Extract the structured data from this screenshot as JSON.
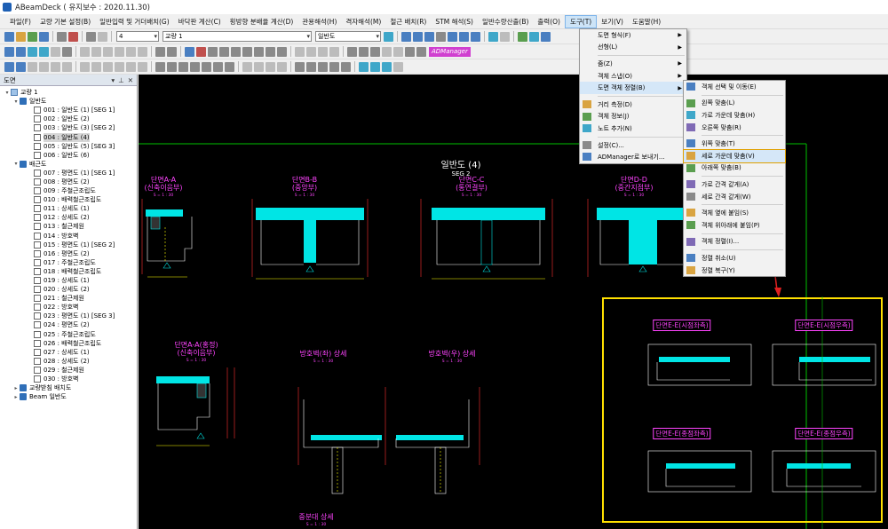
{
  "app": {
    "title": "ABeamDeck  ( 유지보수 : 2020.11.30)"
  },
  "menubar": [
    "파일(F)",
    "교량 기본 설정(B)",
    "일반입력 및 거더배치(G)",
    "바닥판 계산(C)",
    "횡방향 분배율 계산(D)",
    "관용해석(H)",
    "격자해석(M)",
    "철근 배치(R)",
    "STM 해석(S)",
    "일반수량산출(B)",
    "출력(O)",
    "도구(T)",
    "보기(V)",
    "도움말(H)"
  ],
  "toolbar": {
    "page_input": "4",
    "bridge_select": "교량 1",
    "drawing_select": "일반도",
    "admanager": "ADManager"
  },
  "panel": {
    "title": "도면",
    "tree": [
      {
        "level": 0,
        "label": "교량 1",
        "type": "root",
        "toggle": "▾"
      },
      {
        "level": 1,
        "label": "일반도",
        "type": "folder",
        "toggle": "▾"
      },
      {
        "level": 2,
        "label": "001 : 일반도 (1) [SEG 1]",
        "type": "doc"
      },
      {
        "level": 2,
        "label": "002 : 일반도 (2)",
        "type": "doc"
      },
      {
        "level": 2,
        "label": "003 : 일반도 (3) [SEG 2]",
        "type": "doc"
      },
      {
        "level": 2,
        "label": "004 : 일반도 (4)",
        "type": "doc",
        "selected": true
      },
      {
        "level": 2,
        "label": "005 : 일반도 (5) [SEG 3]",
        "type": "doc"
      },
      {
        "level": 2,
        "label": "006 : 일반도 (6)",
        "type": "doc"
      },
      {
        "level": 1,
        "label": "배근도",
        "type": "folder",
        "toggle": "▾"
      },
      {
        "level": 2,
        "label": "007 : 평면도 (1) [SEG 1]",
        "type": "doc"
      },
      {
        "level": 2,
        "label": "008 : 평면도 (2)",
        "type": "doc"
      },
      {
        "level": 2,
        "label": "009 : 주철근조립도",
        "type": "doc"
      },
      {
        "level": 2,
        "label": "010 : 배력철근조립도",
        "type": "doc"
      },
      {
        "level": 2,
        "label": "011 : 상세도 (1)",
        "type": "doc"
      },
      {
        "level": 2,
        "label": "012 : 상세도 (2)",
        "type": "doc"
      },
      {
        "level": 2,
        "label": "013 : 철근제원",
        "type": "doc"
      },
      {
        "level": 2,
        "label": "014 : 방호벽",
        "type": "doc"
      },
      {
        "level": 2,
        "label": "015 : 평면도 (1) [SEG 2]",
        "type": "doc"
      },
      {
        "level": 2,
        "label": "016 : 평면도 (2)",
        "type": "doc"
      },
      {
        "level": 2,
        "label": "017 : 주철근조립도",
        "type": "doc"
      },
      {
        "level": 2,
        "label": "018 : 배력철근조립도",
        "type": "doc"
      },
      {
        "level": 2,
        "label": "019 : 상세도 (1)",
        "type": "doc"
      },
      {
        "level": 2,
        "label": "020 : 상세도 (2)",
        "type": "doc"
      },
      {
        "level": 2,
        "label": "021 : 철근제원",
        "type": "doc"
      },
      {
        "level": 2,
        "label": "022 : 방호벽",
        "type": "doc"
      },
      {
        "level": 2,
        "label": "023 : 평면도 (1) [SEG 3]",
        "type": "doc"
      },
      {
        "level": 2,
        "label": "024 : 평면도 (2)",
        "type": "doc"
      },
      {
        "level": 2,
        "label": "025 : 주철근조립도",
        "type": "doc"
      },
      {
        "level": 2,
        "label": "026 : 배력철근조립도",
        "type": "doc"
      },
      {
        "level": 2,
        "label": "027 : 상세도 (1)",
        "type": "doc"
      },
      {
        "level": 2,
        "label": "028 : 상세도 (2)",
        "type": "doc"
      },
      {
        "level": 2,
        "label": "029 : 철근제원",
        "type": "doc"
      },
      {
        "level": 2,
        "label": "030 : 방호벽",
        "type": "doc"
      },
      {
        "level": 1,
        "label": "교량받침 배치도",
        "type": "folder",
        "toggle": "▸"
      },
      {
        "level": 1,
        "label": "Beam 일반도",
        "type": "folder",
        "toggle": "▸"
      }
    ]
  },
  "drawing": {
    "title": "일반도 (4)",
    "seg": "SEG 2",
    "section_labels": [
      [
        "단면A-A",
        "(신축이음부)"
      ],
      [
        "단면B-B",
        "(중앙부)"
      ],
      [
        "단면C-C",
        "(통연결부)"
      ],
      [
        "단면D-D",
        "(중간지점부)"
      ],
      [
        "단면A-A(홍정)",
        "(신축이음부)"
      ],
      [
        "방호벽(좌) 상세"
      ],
      [
        "방호벽(우) 상세"
      ],
      [
        "중분대 상세"
      ]
    ],
    "scale_note": "S = 1 : 30",
    "box_labels": [
      "단면E-E(시점좌측)",
      "단면E-E(시점우측)",
      "단면E-E(종점좌측)",
      "단면E-E(종점우측)"
    ]
  },
  "tools_menu": [
    {
      "label": "도면 형식(F)",
      "sub": true
    },
    {
      "label": "선형(L)",
      "sub": true
    },
    {
      "sep": true
    },
    {
      "label": "줌(Z)",
      "sub": true
    },
    {
      "label": "객체 스냅(O)",
      "sub": true
    },
    {
      "label": "도면 객체 정렬(B)",
      "sub": true,
      "highlight": true
    },
    {
      "sep": true
    },
    {
      "label": "거리 측정(D)",
      "icon": "measure-icon"
    },
    {
      "label": "객체 정보(J)",
      "icon": "object-info-icon"
    },
    {
      "label": "노트 추가(N)",
      "icon": "note-icon"
    },
    {
      "sep": true
    },
    {
      "label": "설정(C)...",
      "icon": "settings-icon"
    },
    {
      "label": "ADManager로 보내기...",
      "icon": "send-icon"
    }
  ],
  "align_menu": [
    {
      "label": "객체 선택 및 이동(E)",
      "icon": "select-move-icon"
    },
    {
      "sep": true
    },
    {
      "label": "왼쪽 맞춤(L)",
      "icon": "align-left-icon"
    },
    {
      "label": "가로 가운데 맞춤(H)",
      "icon": "align-hcenter-icon"
    },
    {
      "label": "오른쪽 맞춤(R)",
      "icon": "align-right-icon"
    },
    {
      "sep": true
    },
    {
      "label": "위쪽 맞춤(T)",
      "icon": "align-top-icon"
    },
    {
      "label": "세로 가운데 맞춤(V)",
      "icon": "align-vcenter-icon",
      "boxhl": true
    },
    {
      "label": "아래쪽 맞춤(B)",
      "icon": "align-bottom-icon"
    },
    {
      "sep": true
    },
    {
      "label": "가로 간격 같게(A)",
      "icon": "hspace-icon"
    },
    {
      "label": "세로 간격 같게(W)",
      "icon": "vspace-icon"
    },
    {
      "sep": true
    },
    {
      "label": "객체 옆에 붙임(S)",
      "icon": "attach-side-icon"
    },
    {
      "label": "객체 위아래에 붙임(P)",
      "icon": "attach-vertical-icon"
    },
    {
      "sep": true
    },
    {
      "label": "객체 정렬(I)...",
      "icon": "arrange-icon"
    },
    {
      "sep": true
    },
    {
      "label": "정렬 취소(U)",
      "icon": "undo-align-icon"
    },
    {
      "label": "정렬 복구(Y)",
      "icon": "redo-align-icon"
    }
  ],
  "colors": {
    "accent": "#00ffff",
    "magenta": "#ff44ff",
    "highlight_box": "#ffe000",
    "arrow": "#e02020"
  }
}
